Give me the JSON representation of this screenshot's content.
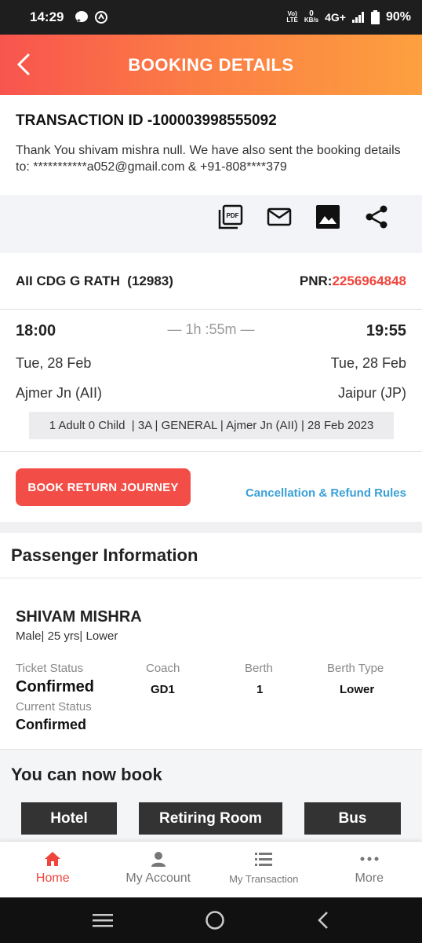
{
  "status_bar": {
    "time": "14:29",
    "network_label_top": "Vo)",
    "network_label_bottom": "LTE",
    "speed_value": "0",
    "speed_unit": "KB/s",
    "network_type": "4G+",
    "battery": "90%"
  },
  "header": {
    "title": "BOOKING DETAILS"
  },
  "transaction": {
    "id": "TRANSACTION ID -100003998555092",
    "message": "Thank You shivam mishra null. We have also sent the booking details to: ***********a052@gmail.com & +91-808****379"
  },
  "share_icons": [
    "pdf-icon",
    "mail-icon",
    "image-icon",
    "share-icon"
  ],
  "train": {
    "name": "AII CDG G RATH  (12983)",
    "pnr_label": "PNR:",
    "pnr": "2256964848"
  },
  "journey": {
    "depart_time": "18:00",
    "arrive_time": "19:55",
    "duration": "— 1h :55m —",
    "depart_date": "Tue, 28 Feb",
    "arrive_date": "Tue, 28 Feb",
    "from_station": "Ajmer Jn (AII)",
    "to_station": "Jaipur (JP)",
    "summary": "1 Adult 0 Child  | 3A | GENERAL | Ajmer Jn (AII) | 28 Feb 2023"
  },
  "actions": {
    "book_return": "BOOK RETURN JOURNEY",
    "cancellation_rules": "Cancellation & Refund Rules"
  },
  "passenger_section": {
    "title": "Passenger Information"
  },
  "passenger": {
    "name": "SHIVAM MISHRA",
    "details": "Male| 25 yrs| Lower",
    "ticket_status_label": "Ticket Status",
    "ticket_status": "Confirmed",
    "coach_label": "Coach",
    "coach": "GD1",
    "berth_label": "Berth",
    "berth": "1",
    "berth_type_label": "Berth Type",
    "berth_type": "Lower",
    "current_status_label": "Current Status",
    "current_status": "Confirmed"
  },
  "now_book": {
    "title": "You can now book",
    "hotel": "Hotel",
    "retiring_room": "Retiring Room",
    "bus": "Bus"
  },
  "bottom_nav": {
    "home": "Home",
    "account": "My Account",
    "transaction": "My Transaction",
    "more": "More"
  },
  "colors": {
    "accent": "#f0453c",
    "header_start": "#f8544e",
    "header_end": "#fda03f",
    "link": "#3aa0d8"
  }
}
